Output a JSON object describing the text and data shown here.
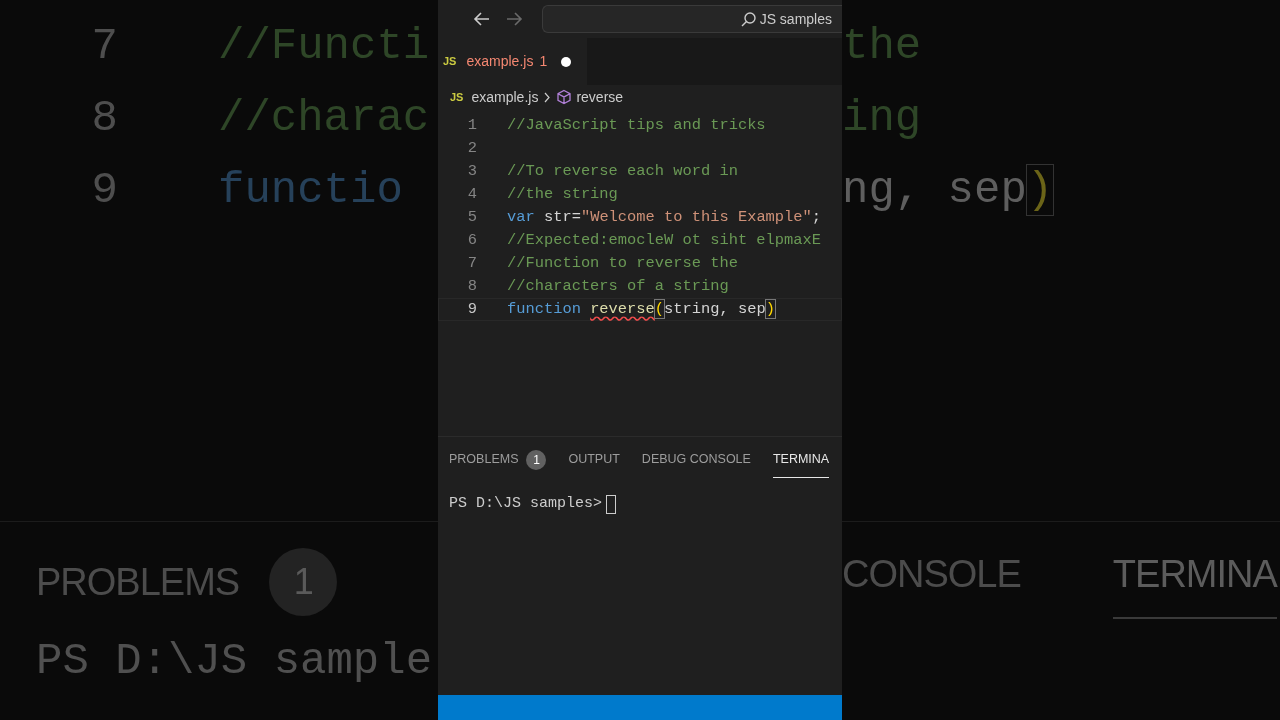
{
  "backdrop_left": {
    "code_lines": [
      {
        "number": "7",
        "tokens": [
          {
            "text": "//Functi",
            "kind": "comment"
          }
        ]
      },
      {
        "number": "8",
        "tokens": [
          {
            "text": "//charac",
            "kind": "comment"
          }
        ]
      },
      {
        "number": "9",
        "tokens": [
          {
            "text": "functio",
            "kind": "keyword"
          }
        ]
      }
    ],
    "panel_tabs": [
      {
        "label": "PROBLEMS",
        "badge": "1"
      }
    ],
    "prompt": "PS D:\\JS sample"
  },
  "backdrop_right": {
    "code_lines": [
      {
        "tokens": [
          {
            "text": "the",
            "kind": "comment"
          }
        ]
      },
      {
        "tokens": [
          {
            "text": "ing",
            "kind": "comment"
          }
        ]
      },
      {
        "tokens": [
          {
            "text": "ng, sep",
            "kind": "plain"
          },
          {
            "text": ")",
            "kind": "bracket"
          }
        ]
      }
    ],
    "panel_tabs": [
      {
        "label": "CONSOLE",
        "selected": false
      },
      {
        "label": "TERMINA",
        "selected": true
      }
    ]
  },
  "title_bar": {
    "search": "JS samples",
    "back_enabled": true,
    "forward_enabled": false
  },
  "tabs": [
    {
      "icon": "JS",
      "label": "example.js",
      "problems": "1",
      "modified": true,
      "selected": true
    }
  ],
  "breadcrumb": {
    "icon": "JS",
    "file": "example.js",
    "symbol": "reverse"
  },
  "editor": {
    "lines": [
      {
        "number": "1",
        "current": false,
        "tokens": [
          {
            "text": "//JavaScript tips and tricks",
            "kind": "comment"
          }
        ]
      },
      {
        "number": "2",
        "current": false
      },
      {
        "number": "3",
        "current": false,
        "tokens": [
          {
            "text": "//To reverse each word in",
            "kind": "comment"
          }
        ]
      },
      {
        "number": "4",
        "current": false,
        "tokens": [
          {
            "text": "//the string",
            "kind": "comment"
          }
        ]
      },
      {
        "number": "5",
        "current": false,
        "tokens": [
          {
            "text": "var",
            "kind": "keyword"
          },
          {
            "text": " str=",
            "kind": "plain"
          },
          {
            "text": "\"Welcome to this Example\"",
            "kind": "string"
          },
          {
            "text": ";",
            "kind": "plain"
          }
        ]
      },
      {
        "number": "6",
        "current": false,
        "tokens": [
          {
            "text": "//Expected:emocleW ot siht elpmaxE",
            "kind": "comment"
          }
        ]
      },
      {
        "number": "7",
        "current": false,
        "tokens": [
          {
            "text": "//Function to reverse the",
            "kind": "comment"
          }
        ]
      },
      {
        "number": "8",
        "current": false,
        "tokens": [
          {
            "text": "//characters of a string",
            "kind": "comment"
          }
        ]
      },
      {
        "number": "9",
        "current": true,
        "tokens": [
          {
            "text": "function",
            "kind": "keyword"
          },
          {
            "text": "reverse",
            "kind": "error"
          },
          {
            "text": "(",
            "kind": "bracket"
          },
          {
            "text": "string, sep",
            "kind": "plain"
          },
          {
            "text": ")",
            "kind": "bracket"
          }
        ]
      }
    ]
  },
  "panel": {
    "tabs": [
      {
        "label": "PROBLEMS",
        "badge": "1",
        "selected": false
      },
      {
        "label": "OUTPUT",
        "selected": false
      },
      {
        "label": "DEBUG CONSOLE",
        "selected": false
      },
      {
        "label": "TERMINA",
        "selected": true
      }
    ],
    "terminal": {
      "prompt": "PS D:\\JS samples>"
    }
  }
}
